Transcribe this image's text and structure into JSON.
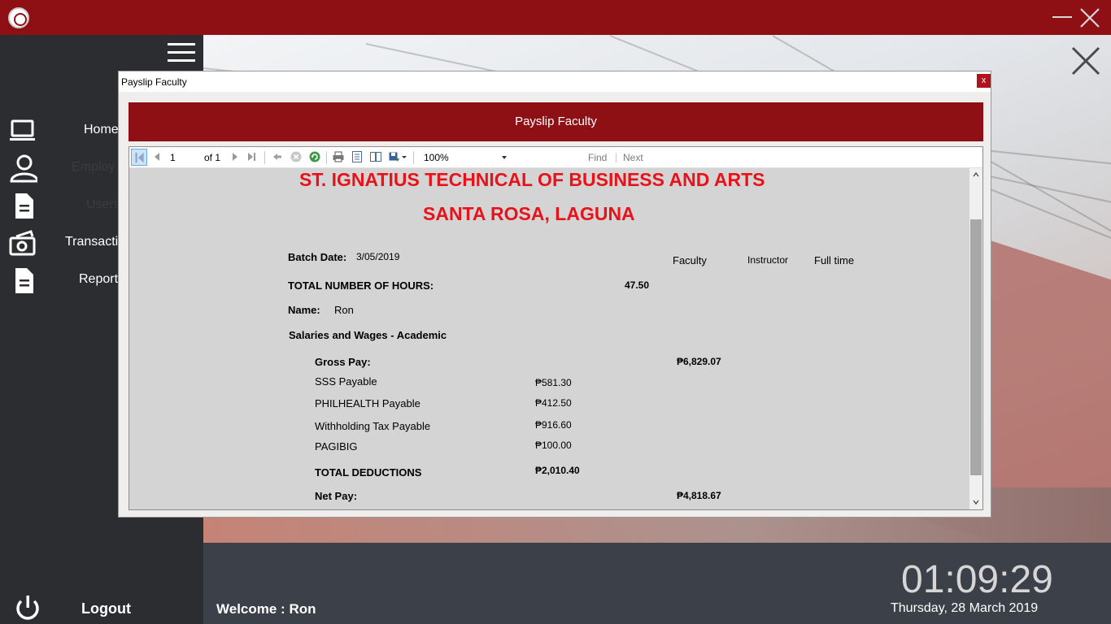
{
  "sidebar": {
    "items": [
      {
        "label": "Home",
        "icon": "laptop-icon"
      },
      {
        "label": "Employ",
        "icon": "user-icon"
      },
      {
        "label": "Users",
        "icon": "document-icon"
      },
      {
        "label": "Transacti",
        "icon": "cash-icon"
      },
      {
        "label": "Report",
        "icon": "report-icon"
      }
    ],
    "logout_label": "Logout"
  },
  "status": {
    "welcome_prefix": "Welcome : ",
    "user": "Ron",
    "time": "01:09:29",
    "date": "Thursday, 28 March 2019"
  },
  "dialog": {
    "window_title": "Payslip Faculty",
    "close_label": "x",
    "header": "Payslip Faculty",
    "toolbar": {
      "page_current": "1",
      "page_of": "of",
      "page_total": "1",
      "zoom": "100%",
      "find_label": "Find",
      "next_label": "Next"
    }
  },
  "report": {
    "school_name": "ST. IGNATIUS TECHNICAL OF BUSINESS AND ARTS",
    "location": "SANTA ROSA, LAGUNA",
    "batch_date_label": "Batch Date:",
    "batch_date": "3/05/2019",
    "category": "Faculty",
    "position": "Instructor",
    "employment": "Full time",
    "total_hours_label": "TOTAL NUMBER OF HOURS:",
    "total_hours": "47.50",
    "name_label": "Name:",
    "name": "Ron",
    "section_title": "Salaries and Wages - Academic",
    "gross_pay_label": "Gross Pay:",
    "gross_pay": "₱6,829.07",
    "deductions": [
      {
        "label": "SSS Payable",
        "amount": "₱581.30"
      },
      {
        "label": "PHILHEALTH Payable",
        "amount": "₱412.50"
      },
      {
        "label": "Withholding Tax Payable",
        "amount": "₱916.60"
      },
      {
        "label": "PAGIBIG",
        "amount": "₱100.00"
      }
    ],
    "total_deductions_label": "TOTAL DEDUCTIONS",
    "total_deductions": "₱2,010.40",
    "net_pay_label": "Net Pay:",
    "net_pay": "₱4,818.67"
  },
  "colors": {
    "brand_red": "#8e1015",
    "report_title_red": "#e8121a",
    "sidebar_bg": "#2b2d30",
    "statusbar_bg": "#3c4048"
  }
}
